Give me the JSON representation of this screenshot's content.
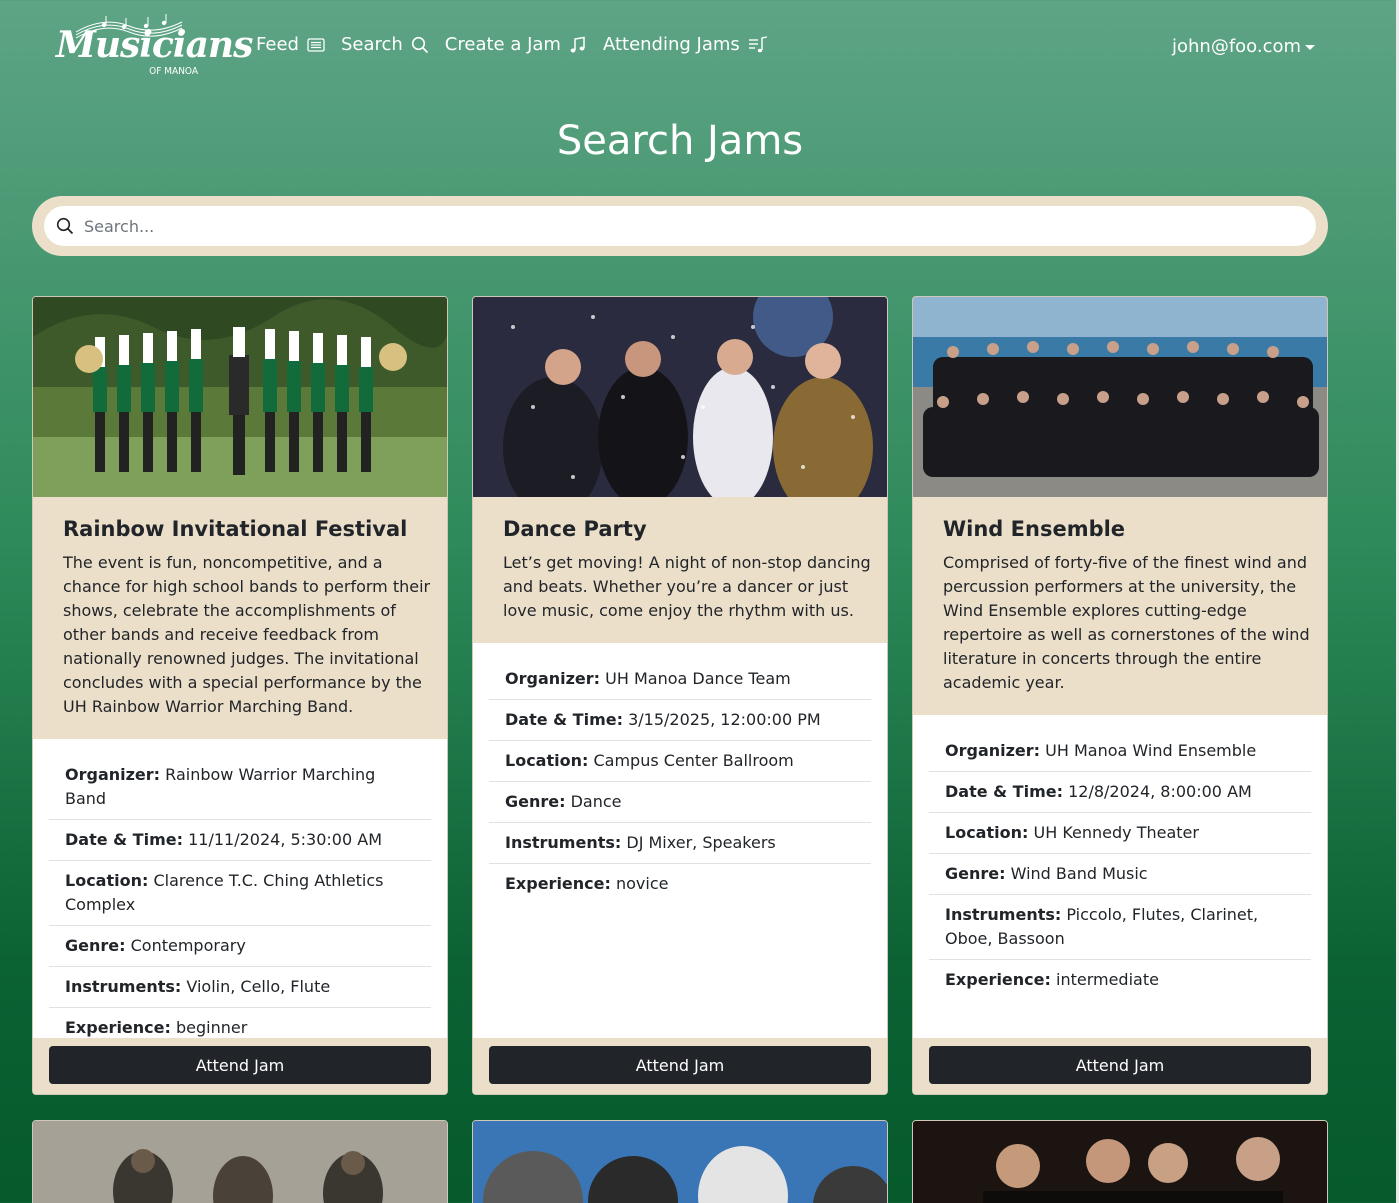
{
  "nav": {
    "logo_text": "Musicians",
    "logo_sub": "OF MANOA",
    "links": [
      {
        "label": "Feed",
        "icon": "newspaper-icon"
      },
      {
        "label": "Search",
        "icon": "search-icon"
      },
      {
        "label": "Create a Jam",
        "icon": "music-note-icon"
      },
      {
        "label": "Attending Jams",
        "icon": "music-list-icon"
      }
    ],
    "user": "john@foo.com"
  },
  "page": {
    "title": "Search Jams",
    "search_placeholder": "Search...",
    "search_value": ""
  },
  "labels": {
    "organizer": "Organizer:",
    "datetime": "Date & Time:",
    "location": "Location:",
    "genre": "Genre:",
    "instruments": "Instruments:",
    "experience": "Experience:",
    "attend": "Attend Jam"
  },
  "jams": [
    {
      "title": "Rainbow Invitational Festival",
      "description": "The event is fun, noncompetitive, and a chance for high school bands to perform their shows, celebrate the accomplishments of other bands and receive feedback from nationally renowned judges. The invitational concludes with a special performance by the UH Rainbow Warrior Marching Band.",
      "organizer": "Rainbow Warrior Marching Band",
      "datetime": "11/11/2024, 5:30:00 AM",
      "location": "Clarence T.C. Ching Athletics Complex",
      "genre": "Contemporary",
      "instruments": "Violin, Cello, Flute",
      "experience": "beginner"
    },
    {
      "title": "Dance Party",
      "description": "Let’s get moving! A night of non-stop dancing and beats. Whether you’re a dancer or just love music, come enjoy the rhythm with us.",
      "organizer": "UH Manoa Dance Team",
      "datetime": "3/15/2025, 12:00:00 PM",
      "location": "Campus Center Ballroom",
      "genre": "Dance",
      "instruments": "DJ Mixer, Speakers",
      "experience": "novice"
    },
    {
      "title": "Wind Ensemble",
      "description": "Comprised of forty-five of the finest wind and percussion performers at the university, the Wind Ensemble explores cutting-edge repertoire as well as cornerstones of the wind literature in concerts through the entire academic year.",
      "organizer": "UH Manoa Wind Ensemble",
      "datetime": "12/8/2024, 8:00:00 AM",
      "location": "UH Kennedy Theater",
      "genre": "Wind Band Music",
      "instruments": "Piccolo, Flutes, Clarinet, Oboe, Bassoon",
      "experience": "intermediate"
    }
  ]
}
